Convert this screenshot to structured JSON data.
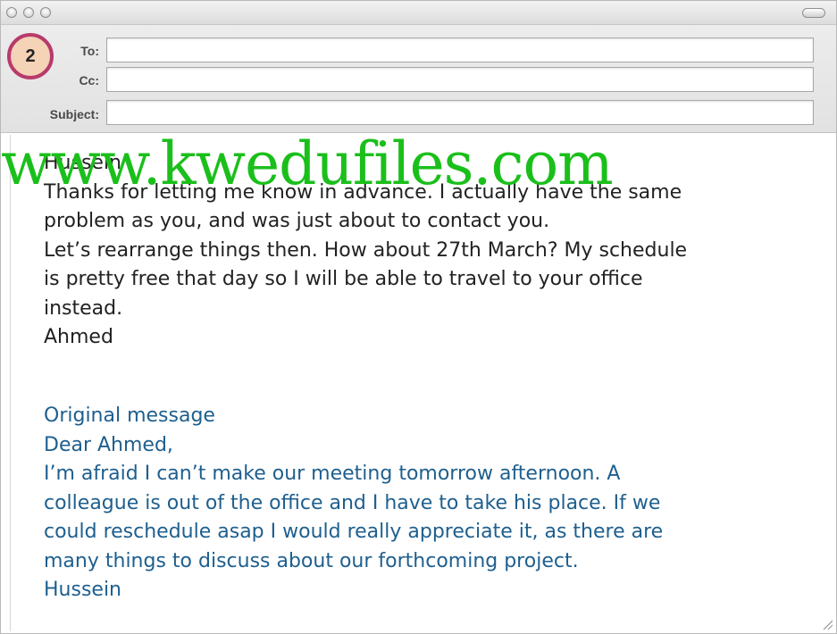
{
  "badge": {
    "number": "2"
  },
  "fields": {
    "to": {
      "label": "To:",
      "value": ""
    },
    "cc": {
      "label": "Cc:",
      "value": ""
    },
    "subject": {
      "label": "Subject:",
      "value": ""
    }
  },
  "reply": {
    "lines": [
      "Hussein",
      "Thanks for letting me know in advance. I actually have the same",
      "problem as you, and was just about to contact you.",
      "Let’s rearrange things then. How about 27th March? My schedule",
      "is pretty free that day so I will be able to travel to your office",
      "instead.",
      "Ahmed"
    ]
  },
  "original": {
    "lines": [
      "Original message",
      "Dear Ahmed,",
      "I’m afraid I can’t make our meeting tomorrow afternoon. A",
      "colleague is out of the office and I have to take his place. If we",
      "could reschedule asap I would really appreciate it, as there are",
      "many things to discuss about our forthcoming project.",
      "Hussein"
    ]
  },
  "watermark": {
    "text": "www.kwedufiles.com"
  },
  "colors": {
    "reply_text": "#222222",
    "original_text": "#1e5f8e",
    "watermark": "#1bbf1b",
    "badge_border": "#b83a6b",
    "badge_fill": "#f4d3b6"
  }
}
